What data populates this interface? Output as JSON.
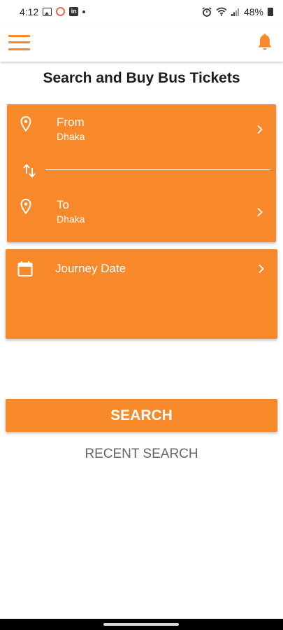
{
  "status_bar": {
    "time": "4:12",
    "battery": "48%",
    "linkedin_label": "in",
    "icons": [
      "image-icon",
      "ring-icon",
      "linkedin-icon",
      "dot-icon",
      "alarm-icon",
      "wifi-icon",
      "signal-icon",
      "battery-icon"
    ]
  },
  "app_bar": {
    "menu_icon": "hamburger-menu-icon",
    "notification_icon": "bell-icon"
  },
  "page": {
    "title": "Search and Buy Bus Tickets"
  },
  "route": {
    "from_label": "From",
    "from_value": "Dhaka",
    "to_label": "To",
    "to_value": "Dhaka",
    "swap_icon": "swap-vertical-icon"
  },
  "journey": {
    "label": "Journey Date"
  },
  "actions": {
    "search_label": "SEARCH",
    "recent_label": "RECENT SEARCH"
  },
  "colors": {
    "accent": "#f7892a",
    "text_dark": "#1c1c1c",
    "text_muted": "#666666"
  }
}
